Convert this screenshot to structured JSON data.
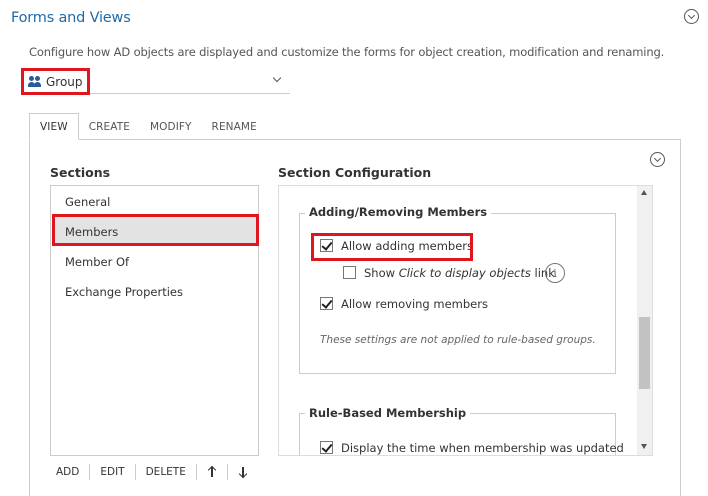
{
  "header": {
    "title": "Forms and Views",
    "description": "Configure how AD objects are displayed and customize the forms for object creation, modification and renaming."
  },
  "object_type": {
    "selected": "Group",
    "icon": "group-icon"
  },
  "tabs": [
    {
      "label": "VIEW",
      "active": true
    },
    {
      "label": "CREATE",
      "active": false
    },
    {
      "label": "MODIFY",
      "active": false
    },
    {
      "label": "RENAME",
      "active": false
    }
  ],
  "sections": {
    "title": "Sections",
    "items": [
      "General",
      "Members",
      "Member Of",
      "Exchange Properties"
    ],
    "selected": "Members",
    "toolbar": {
      "add": "ADD",
      "edit": "EDIT",
      "delete": "DELETE"
    }
  },
  "section_config": {
    "title": "Section Configuration",
    "adding_removing": {
      "legend": "Adding/Removing Members",
      "allow_adding": {
        "label": "Allow adding members",
        "checked": true
      },
      "show_link": {
        "prefix": "Show ",
        "italic": "Click to display objects",
        "suffix": " link",
        "checked": false
      },
      "allow_removing": {
        "label": "Allow removing members",
        "checked": true
      },
      "note": "These settings are not applied to rule-based groups."
    },
    "rule_based": {
      "legend": "Rule-Based Membership",
      "display_time": {
        "label": "Display the time when membership was updated",
        "checked": true
      }
    }
  },
  "colors": {
    "title": "#1e6aa8",
    "highlight": "#e0161f",
    "selected_row": "#e3e3e3"
  }
}
